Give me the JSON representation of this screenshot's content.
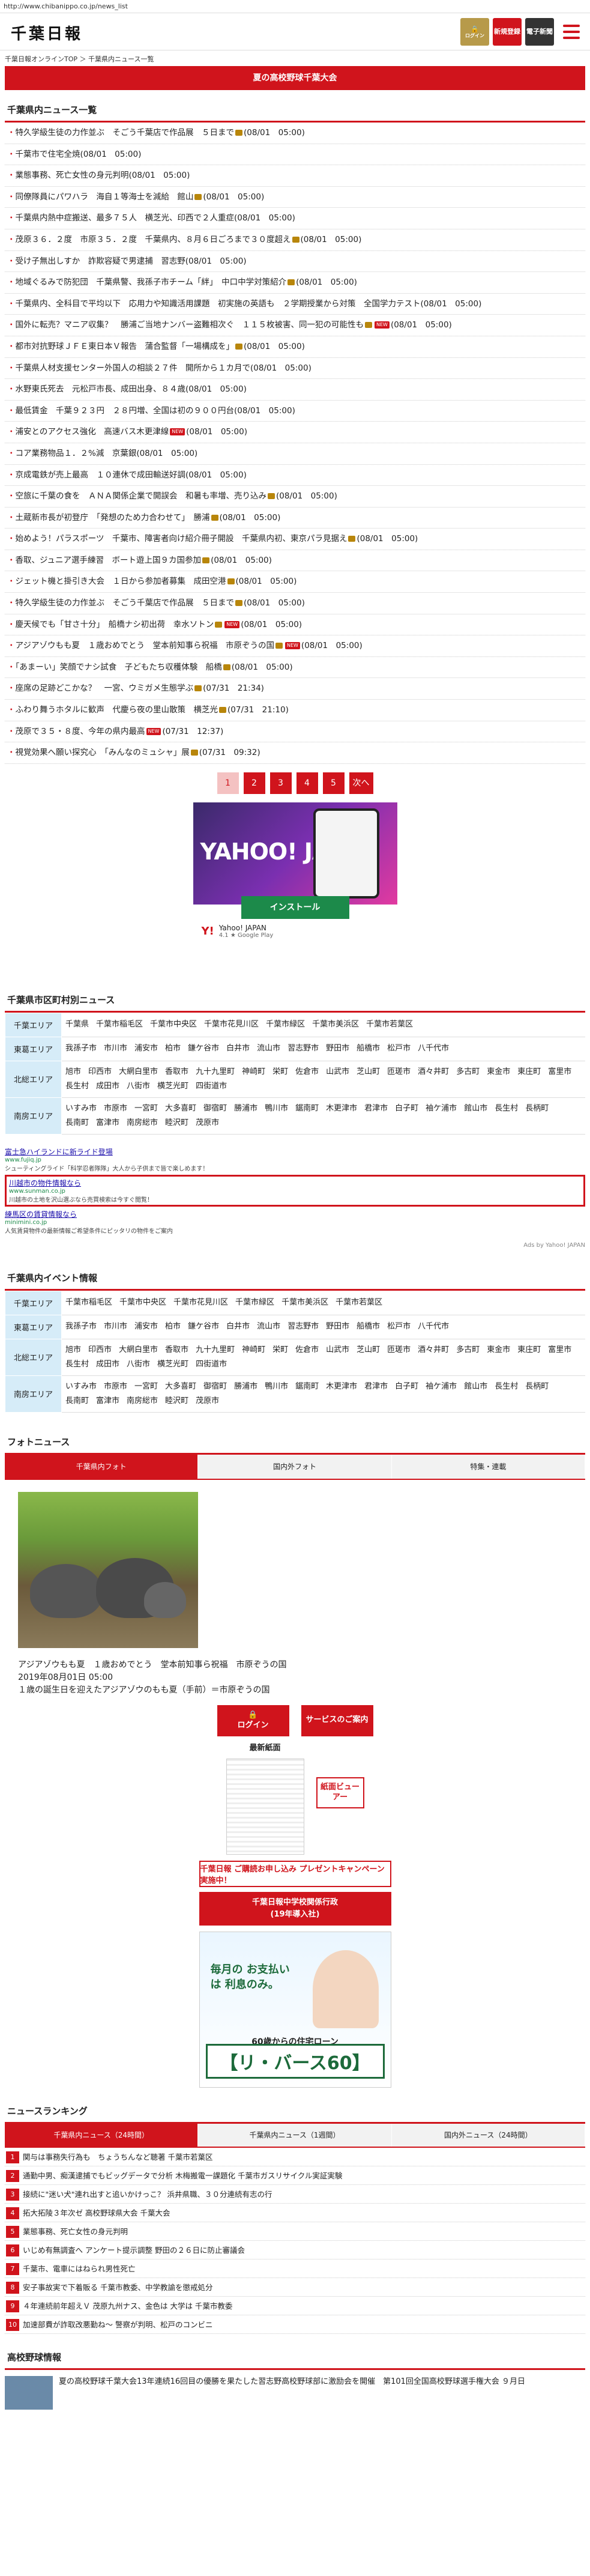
{
  "url": "http://www.chibanippo.co.jp/news_list",
  "header": {
    "logo": "千葉日報",
    "login_label": "ログイン",
    "register_label": "新規登録",
    "epaper_label": "電子新聞"
  },
  "breadcrumb": "千葉日報オンラインTOP ＞ 千葉県内ニュース一覧",
  "banner": "夏の高校野球千葉大会",
  "news_section_title": "千葉県内ニュース一覧",
  "news": [
    {
      "text": "特久学級生徒の力作並ぶ　そごう千葉店で作品展　５日まで",
      "date": "(08/01　05:00)",
      "photo": true,
      "new": false
    },
    {
      "text": "千葉市で住宅全焼",
      "date": "(08/01　05:00)",
      "photo": false,
      "new": false
    },
    {
      "text": "業態事務、死亡女性の身元判明",
      "date": "(08/01　05:00)",
      "photo": false,
      "new": false
    },
    {
      "text": "同僚隊員にパワハラ　海自１等海士を減給　館山",
      "date": "(08/01　05:00)",
      "photo": true,
      "new": false
    },
    {
      "text": "千葉県内熱中症搬送、最多７５人　横芝光、印西で２人重症",
      "date": "(08/01　05:00)",
      "photo": false,
      "new": false
    },
    {
      "text": "茂原３６．２度　市原３５．２度　千葉県内、８月６日ごろまで３０度超え",
      "date": "(08/01　05:00)",
      "photo": true,
      "new": false
    },
    {
      "text": "受け子無出しすか　詐欺容疑で男逮捕　習志野",
      "date": "(08/01　05:00)",
      "photo": false,
      "new": false
    },
    {
      "text": "地域ぐるみで防犯団　千葉県警、我孫子市チーム「絆」　中口中学対策紹介",
      "date": "(08/01　05:00)",
      "photo": true,
      "new": false
    },
    {
      "text": "千葉県内、全科目で平均以下　応用力や知識活用課題　初実施の英語も　２学期授業から対策　全国学力テスト",
      "date": "(08/01　05:00)",
      "photo": false,
      "new": false
    },
    {
      "text": "国外に転売？マニア収集？　勝浦ご当地ナンバー盗難相次ぐ　１１５枚被害、同一犯の可能性も",
      "date": "(08/01　05:00)",
      "photo": true,
      "new": true
    },
    {
      "text": "都市対抗野球ＪＦＥ東日本Ｖ報告　蒲合監督「一場構成を」",
      "date": "(08/01　05:00)",
      "photo": true,
      "new": false
    },
    {
      "text": "千葉県人材支援センター外国人の相談２７件　開所から１カ月で",
      "date": "(08/01　05:00)",
      "photo": false,
      "new": false
    },
    {
      "text": "水野東氏死去　元松戸市長、成田出身、８４歳",
      "date": "(08/01　05:00)",
      "photo": false,
      "new": false
    },
    {
      "text": "最低賃金　千葉９２３円　２８円増、全国は初の９００円台",
      "date": "(08/01　05:00)",
      "photo": false,
      "new": false
    },
    {
      "text": "浦安とのアクセス強化　高速バス木更津線",
      "date": "(08/01　05:00)",
      "photo": false,
      "new": true
    },
    {
      "text": "コア業務物品１．２%減　京葉銀",
      "date": "(08/01　05:00)",
      "photo": false,
      "new": false
    },
    {
      "text": "京成電鉄が売上最高　１０連休で成田輸送好調",
      "date": "(08/01　05:00)",
      "photo": false,
      "new": false
    },
    {
      "text": "空旅に千葉の食を　ＡＮＡ関係企業で開誤会　和暑も率増、売り込み",
      "date": "(08/01　05:00)",
      "photo": true,
      "new": false
    },
    {
      "text": "土蔵新市長が初登庁　「発想のため力合わせて」　勝浦",
      "date": "(08/01　05:00)",
      "photo": true,
      "new": false
    },
    {
      "text": "始めよう！パラスポーツ　千葉市、障害者向け紹介冊子開設　千葉県内初、東京パラ見据え",
      "date": "(08/01　05:00)",
      "photo": true,
      "new": false
    },
    {
      "text": "香取、ジュニア選手練習　ボート遊上国９カ国参加",
      "date": "(08/01　05:00)",
      "photo": true,
      "new": false
    },
    {
      "text": "ジェット機と掛引き大会　１日から参加者募集　成田空港",
      "date": "(08/01　05:00)",
      "photo": true,
      "new": false
    },
    {
      "text": "特久学級生徒の力作並ぶ　そごう千葉店で作品展　５日まで",
      "date": "(08/01　05:00)",
      "photo": true,
      "new": false
    },
    {
      "text": "慶天候でも「甘さ十分」　船橋ナシ初出荷　幸水ソトン",
      "date": "(08/01　05:00)",
      "photo": true,
      "new": true
    },
    {
      "text": "アジアゾウもも夏　１歳おめでとう　堂本前知事ら祝福　市原ぞうの国",
      "date": "(08/01　05:00)",
      "photo": true,
      "new": true
    },
    {
      "text": "「あまーい」笑顔でナシ試食　子どもたち収穫体験　船橋",
      "date": "(08/01　05:00)",
      "photo": true,
      "new": false
    },
    {
      "text": "座席の足跡どこかな？　一宮、ウミガメ生態学ぶ",
      "date": "(07/31　21:34)",
      "photo": true,
      "new": false
    },
    {
      "text": "ふわり舞うホタルに歓声　代慶ら夜の里山散策　横芝光",
      "date": "(07/31　21:10)",
      "photo": true,
      "new": false
    },
    {
      "text": "茂原で３５・８度、今年の県内最高",
      "date": "(07/31　12:37)",
      "photo": false,
      "new": true
    },
    {
      "text": "視覚効果へ願い探究心　「みんなのミュシャ」展",
      "date": "(07/31　09:32)",
      "photo": true,
      "new": false
    }
  ],
  "pager": {
    "pages": [
      "1",
      "2",
      "3",
      "4",
      "5"
    ],
    "next": "次へ"
  },
  "ad": {
    "brand": "YAHOO! JAPAN",
    "install": "インストール",
    "app_name": "Yahoo! JAPAN",
    "rating": "4.1",
    "store": "Google Play"
  },
  "city_section_title": "千葉県市区町村別ニュース",
  "city_areas": [
    {
      "area": "千葉エリア",
      "cities": [
        "千葉県",
        "千葉市稲毛区",
        "千葉市中央区",
        "千葉市花見川区",
        "千葉市緑区",
        "千葉市美浜区",
        "千葉市若葉区"
      ]
    },
    {
      "area": "東葛エリア",
      "cities": [
        "我孫子市",
        "市川市",
        "浦安市",
        "柏市",
        "鎌ケ谷市",
        "白井市",
        "流山市",
        "習志野市",
        "野田市",
        "船橋市",
        "松戸市",
        "八千代市"
      ]
    },
    {
      "area": "北総エリア",
      "cities": [
        "旭市",
        "印西市",
        "大網白里市",
        "香取市",
        "九十九里町",
        "神崎町",
        "栄町",
        "佐倉市",
        "山武市",
        "芝山町",
        "匝瑳市",
        "酒々井町",
        "多古町",
        "東金市",
        "東庄町",
        "富里市",
        "長生村",
        "成田市",
        "八街市",
        "横芝光町",
        "四街道市"
      ]
    },
    {
      "area": "南房エリア",
      "cities": [
        "いすみ市",
        "市原市",
        "一宮町",
        "大多喜町",
        "御宿町",
        "勝浦市",
        "鴨川市",
        "鋸南町",
        "木更津市",
        "君津市",
        "白子町",
        "袖ケ浦市",
        "館山市",
        "長生村",
        "長柄町",
        "長南町",
        "富津市",
        "南房総市",
        "睦沢町",
        "茂原市"
      ]
    }
  ],
  "ydn_ads": [
    {
      "title": "富士急ハイランドに新ライド登場",
      "url": "www.fujiq.jp",
      "desc": "シューティングライド「科学忍者隊隊」大人から子供まで皆で楽しめます！",
      "highlight": false
    },
    {
      "title": "川越市の物件情報なら",
      "url": "www.sunman.co.jp",
      "desc": "川越市の土地を沢山選ぶなら売買検索は今すぐ閲覧！",
      "highlight": true
    },
    {
      "title": "練馬区の賃貸情報なら",
      "url": "minimini.co.jp",
      "desc": "人気賃貸物件の最新情報ご希望条件にピッタリの物件をご案内",
      "highlight": false
    }
  ],
  "ydn_footer": "Ads by Yahoo! JAPAN",
  "event_section_title": "千葉県内イベント情報",
  "event_areas": [
    {
      "area": "千葉エリア",
      "cities": [
        "千葉市稲毛区",
        "千葉市中央区",
        "千葉市花見川区",
        "千葉市緑区",
        "千葉市美浜区",
        "千葉市若葉区"
      ]
    },
    {
      "area": "東葛エリア",
      "cities": [
        "我孫子市",
        "市川市",
        "浦安市",
        "柏市",
        "鎌ケ谷市",
        "白井市",
        "流山市",
        "習志野市",
        "野田市",
        "船橋市",
        "松戸市",
        "八千代市"
      ]
    },
    {
      "area": "北総エリア",
      "cities": [
        "旭市",
        "印西市",
        "大網白里市",
        "香取市",
        "九十九里町",
        "神崎町",
        "栄町",
        "佐倉市",
        "山武市",
        "芝山町",
        "匝瑳市",
        "酒々井町",
        "多古町",
        "東金市",
        "東庄町",
        "富里市",
        "長生村",
        "成田市",
        "八街市",
        "横芝光町",
        "四街道市"
      ]
    },
    {
      "area": "南房エリア",
      "cities": [
        "いすみ市",
        "市原市",
        "一宮町",
        "大多喜町",
        "御宿町",
        "勝浦市",
        "鴨川市",
        "鋸南町",
        "木更津市",
        "君津市",
        "白子町",
        "袖ケ浦市",
        "館山市",
        "長生村",
        "長柄町",
        "長南町",
        "富津市",
        "南房総市",
        "睦沢町",
        "茂原市"
      ]
    }
  ],
  "photo_section_title": "フォトニュース",
  "photo_tabs": [
    "千葉県内フォト",
    "国内外フォト",
    "特集・連載"
  ],
  "photo_caption": {
    "title": "アジアゾウもも夏　１歳おめでとう　堂本前知事ら祝福　市原ぞうの国",
    "date": "2019年08月01日 05:00",
    "desc": "１歳の誕生日を迎えたアジアゾウのもも夏（手前）＝市原ぞうの国"
  },
  "side": {
    "login": "ログイン",
    "service": "サービスのご案内",
    "latest": "最新紙面",
    "viewer": "紙面ビューアー",
    "promo": "千葉日報 ご購読お申し込み プレゼントキャンペーン実施中！",
    "promo2_1": "千葉日報中学校関係行政",
    "promo2_2": "(19年導入社)",
    "loan_copy": "毎月の お支払いは 利息のみ。",
    "loan_sub": "60歳からの住宅ローン",
    "loan_big": "【リ・バース60】"
  },
  "ranking_section_title": "ニュースランキング",
  "ranking_tabs": [
    "千葉県内ニュース（24時間）",
    "千葉県内ニュース（1週間）",
    "国内外ニュース（24時間）"
  ],
  "ranking": [
    "関与は事務失行為も　ちょうちんなど聴著 千葉市若葉区",
    "通勤中男、痴漢逮捕でもビッグデータで分析 木梅搬電一課題化 千葉市ガスリサイクル実証実験",
    "接続に\"迷い犬\"連れ出すと追いかけっこ？ 浜井県職、３０分連続有志の行",
    "拓大拓陵３年次ゼ 高校野球県大会 千葉大会",
    "業態事務、死亡女性の身元判明",
    "いじめ有無調査へ アンケート提示調整 野田の２６日に防止審議会",
    "千葉市、電車にはねられ男性死亡",
    "安子事故実で下着販る 千葉市教委、中学教諭を懲戒処分",
    "４年連続前年超えＶ 茂原九州ナス、金色は 大学は 千葉市教委",
    "加速部費が詐取改悪勤ね～ 警察が判明、松戸のコンビニ"
  ],
  "hs_section_title": "高校野球情報",
  "hs_text": "夏の高校野球千葉大会13年連続16回目の優勝を果たした習志野高校野球部に激励会を開催　第101回全国高校野球選手権大会 ９月日",
  "colors": {
    "accent": "#d0141c",
    "area_bg": "#d6ecf8"
  }
}
